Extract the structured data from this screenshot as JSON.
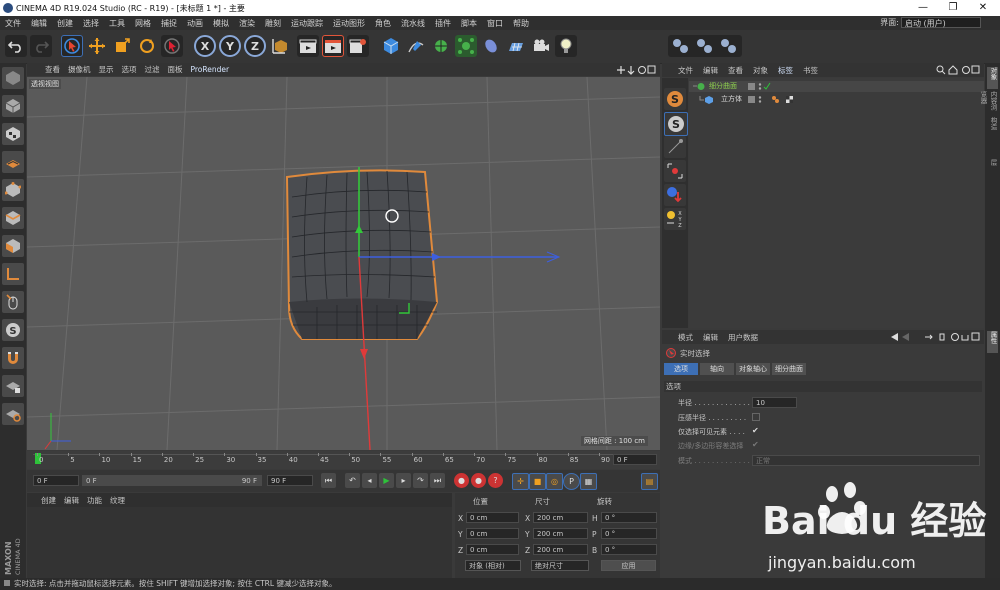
{
  "window": {
    "title": "CINEMA 4D R19.024 Studio (RC - R19) - [未标题 1 *] - 主要",
    "controls": [
      "—",
      "❐",
      "✕"
    ]
  },
  "menubar": {
    "items": [
      "文件",
      "编辑",
      "创建",
      "选择",
      "工具",
      "网格",
      "捕捉",
      "动画",
      "模拟",
      "渲染",
      "雕刻",
      "运动跟踪",
      "运动图形",
      "角色",
      "流水线",
      "插件",
      "脚本",
      "窗口",
      "帮助"
    ],
    "layout_label": "界面:",
    "layout_value": "启动 (用户)"
  },
  "viewport": {
    "menu": [
      "查看",
      "摄像机",
      "显示",
      "选项",
      "过滤",
      "面板",
      "ProRender"
    ],
    "view_name": "透视视图",
    "grid_distance": "网格间距 : 100 cm"
  },
  "timeline": {
    "ticks": [
      "0",
      "5",
      "10",
      "15",
      "20",
      "25",
      "30",
      "35",
      "40",
      "45",
      "50",
      "55",
      "60",
      "65",
      "70",
      "75",
      "80",
      "85",
      "90"
    ],
    "current_frame_field": "0 F"
  },
  "transport": {
    "start_field": "0 F",
    "range_start": "0 F",
    "range_end": "90 F",
    "end_field": "90 F"
  },
  "material_panel": {
    "menu": [
      "创建",
      "编辑",
      "功能",
      "纹理"
    ]
  },
  "coord_panel": {
    "headers": [
      "位置",
      "尺寸",
      "旋转"
    ],
    "rows": [
      {
        "axis": "X",
        "pos": "0 cm",
        "size_axis": "X",
        "size": "200 cm",
        "rot_axis": "H",
        "rot": "0 °"
      },
      {
        "axis": "Y",
        "pos": "0 cm",
        "size_axis": "Y",
        "size": "200 cm",
        "rot_axis": "P",
        "rot": "0 °"
      },
      {
        "axis": "Z",
        "pos": "0 cm",
        "size_axis": "Z",
        "size": "200 cm",
        "rot_axis": "B",
        "rot": "0 °"
      }
    ],
    "mode_select": "对象 (相对)",
    "size_select": "绝对尺寸",
    "apply_button": "应用"
  },
  "object_manager": {
    "menu": [
      "文件",
      "编辑",
      "查看",
      "对象",
      "标签",
      "书签"
    ],
    "objects": [
      {
        "name": "细分曲面",
        "color": "#8fd14f"
      },
      {
        "name": "立方体",
        "color": "#dddddd"
      }
    ]
  },
  "attribute_manager": {
    "menu": [
      "模式",
      "编辑",
      "用户数据"
    ],
    "tool_name": "实时选择",
    "tabs": [
      "选项",
      "轴向",
      "对象轴心",
      "细分曲面"
    ],
    "section": "选项",
    "fields": {
      "radius_label": "半径 . . . . . . . . . . . . .",
      "radius_value": "10",
      "pressure_label": "压感半径 . . . . . . . . .",
      "visible_only_label": "仅选择可见元素 . . . .",
      "visible_only_mark": "✔",
      "edge_label": "边缘/多边形容差选择",
      "edge_mark": "✔",
      "mode_label": "模式 . . . . . . . . . . . . .",
      "mode_value": "正常"
    }
  },
  "side_tabs": [
    "对象",
    "内容浏览器",
    "构造",
    "层"
  ],
  "side_tabs_attr": [
    "属性"
  ],
  "statusbar": {
    "text": "实时选择: 点击并拖动鼠标选择元素。按住 SHIFT 键增加选择对象; 按住 CTRL 键减少选择对象。"
  },
  "branding": {
    "maxon": "MAXON",
    "product": "CINEMA 4D"
  },
  "watermark": {
    "brand": "Bai du 经验",
    "url": "jingyan.baidu.com"
  },
  "colors": {
    "accent_blue": "#3d6fb5",
    "selection_orange": "#e08a3c",
    "viewport_bg": "#5a5a5a"
  }
}
